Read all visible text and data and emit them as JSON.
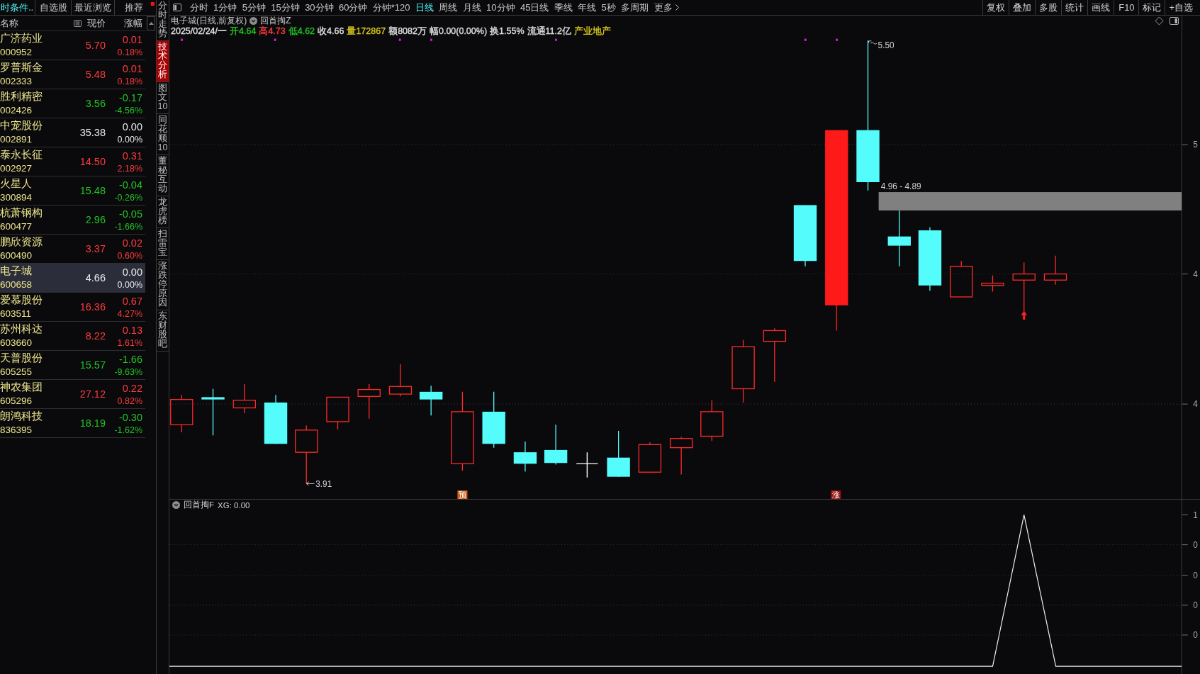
{
  "watchlist": {
    "tabs": [
      {
        "label": "时条件..",
        "selected": true
      },
      {
        "label": "自选股",
        "selected": false
      },
      {
        "label": "最近浏览",
        "selected": false
      },
      {
        "label": "推荐",
        "selected": false
      }
    ],
    "columns": [
      "名称",
      "现价",
      "涨幅"
    ],
    "rows": [
      {
        "name": "广济药业",
        "code": "000952",
        "price": "5.70",
        "change": "0.01",
        "pct": "0.18%",
        "color": "#ff3b3b",
        "selected": false
      },
      {
        "name": "罗普斯金",
        "code": "002333",
        "price": "5.48",
        "change": "0.01",
        "pct": "0.18%",
        "color": "#ff3b3b",
        "selected": false
      },
      {
        "name": "胜利精密",
        "code": "002426",
        "price": "3.56",
        "change": "-0.17",
        "pct": "-4.56%",
        "color": "#22c422",
        "selected": false
      },
      {
        "name": "中宠股份",
        "code": "002891",
        "price": "35.38",
        "change": "0.00",
        "pct": "0.00%",
        "color": "#ececec",
        "selected": false
      },
      {
        "name": "泰永长征",
        "code": "002927",
        "price": "14.50",
        "change": "0.31",
        "pct": "2.18%",
        "color": "#ff3b3b",
        "selected": false
      },
      {
        "name": "火星人",
        "code": "300894",
        "price": "15.48",
        "change": "-0.04",
        "pct": "-0.26%",
        "color": "#22c422",
        "selected": false
      },
      {
        "name": "杭萧钢构",
        "code": "600477",
        "price": "2.96",
        "change": "-0.05",
        "pct": "-1.66%",
        "color": "#22c422",
        "selected": false
      },
      {
        "name": "鹏欣资源",
        "code": "600490",
        "price": "3.37",
        "change": "0.02",
        "pct": "0.60%",
        "color": "#ff3b3b",
        "selected": false
      },
      {
        "name": "电子城",
        "code": "600658",
        "price": "4.66",
        "change": "0.00",
        "pct": "0.00%",
        "color": "#ececec",
        "selected": true
      },
      {
        "name": "爱慕股份",
        "code": "603511",
        "price": "16.36",
        "change": "0.67",
        "pct": "4.27%",
        "color": "#ff3b3b",
        "selected": false
      },
      {
        "name": "苏州科达",
        "code": "603660",
        "price": "8.22",
        "change": "0.13",
        "pct": "1.61%",
        "color": "#ff3b3b",
        "selected": false
      },
      {
        "name": "天普股份",
        "code": "605255",
        "price": "15.57",
        "change": "-1.66",
        "pct": "-9.63%",
        "color": "#22c422",
        "selected": false
      },
      {
        "name": "神农集团",
        "code": "605296",
        "price": "27.12",
        "change": "0.22",
        "pct": "0.82%",
        "color": "#ff3b3b",
        "selected": false
      },
      {
        "name": "朗鸿科技",
        "code": "836395",
        "price": "18.19",
        "change": "-0.30",
        "pct": "-1.62%",
        "color": "#22c422",
        "selected": false
      }
    ]
  },
  "side_tabs": [
    {
      "label": "分时走势",
      "selected": false
    },
    {
      "label": "技术分析",
      "selected": true
    },
    {
      "label": "图文10",
      "selected": false
    },
    {
      "label": "同花顺10",
      "selected": false
    },
    {
      "label": "董秘互动",
      "selected": false
    },
    {
      "label": "龙虎榜",
      "selected": false
    },
    {
      "label": "扫雷宝",
      "selected": false
    },
    {
      "label": "涨跌停原因",
      "selected": false
    },
    {
      "label": "东财股吧",
      "selected": false
    }
  ],
  "toolbar": {
    "periods": [
      {
        "label": "分时",
        "selected": false
      },
      {
        "label": "1分钟",
        "selected": false
      },
      {
        "label": "5分钟",
        "selected": false
      },
      {
        "label": "15分钟",
        "selected": false
      },
      {
        "label": "30分钟",
        "selected": false
      },
      {
        "label": "60分钟",
        "selected": false
      },
      {
        "label": "分钟*120",
        "selected": false
      },
      {
        "label": "日线",
        "selected": true
      },
      {
        "label": "周线",
        "selected": false
      },
      {
        "label": "月线",
        "selected": false
      },
      {
        "label": "10分钟",
        "selected": false
      },
      {
        "label": "45日线",
        "selected": false
      },
      {
        "label": "季线",
        "selected": false
      },
      {
        "label": "年线",
        "selected": false
      },
      {
        "label": "5秒",
        "selected": false
      },
      {
        "label": "多周期",
        "selected": false
      }
    ],
    "more": "更多",
    "tools": [
      "复权",
      "叠加",
      "多股",
      "统计",
      "画线",
      "F10",
      "标记",
      "+自选"
    ]
  },
  "chart": {
    "title": "电子城(日线,前复权)",
    "indicator": "回首掏Z",
    "quote": [
      {
        "text": "2025/02/24/一",
        "color": "#e0e0e0"
      },
      {
        "text": "开4.64",
        "color": "#22c422"
      },
      {
        "text": "高4.73",
        "color": "#ff3b3b"
      },
      {
        "text": "低4.62",
        "color": "#22c422"
      },
      {
        "text": "收4.66",
        "color": "#e0e0e0"
      },
      {
        "text": "量172867",
        "color": "#d8c818"
      },
      {
        "text": "额8082万",
        "color": "#e0e0e0"
      },
      {
        "text": "幅0.00(0.00%)",
        "color": "#e0e0e0"
      },
      {
        "text": "换1.55%",
        "color": "#e0e0e0"
      },
      {
        "text": "流通11.2亿",
        "color": "#e0e0e0"
      },
      {
        "text": "产业地产",
        "color": "#d8c818"
      }
    ],
    "high_label": "5.50",
    "low_label": "3.91",
    "zone_label": "4.96 - 4.89",
    "markers": [
      {
        "text": "预",
        "color": "#d0601a"
      },
      {
        "text": "涨",
        "color": "#9c1414"
      }
    ],
    "axis_labels": [
      "5",
      "4",
      "4"
    ]
  },
  "indicator_panel": {
    "title": "回首掏F",
    "reading": "XG: 0.00",
    "axis_labels": [
      "1",
      "0",
      "0",
      "0",
      "0"
    ]
  }
}
